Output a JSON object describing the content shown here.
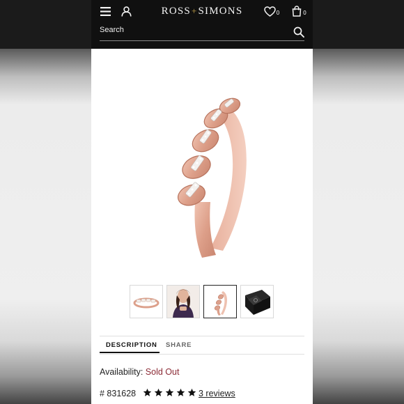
{
  "header": {
    "logo_left": "ROSS",
    "logo_sep": "+",
    "logo_right": "SIMONS",
    "wishlist_count": "0",
    "bag_count": "0",
    "search_label": "Search"
  },
  "gallery": {
    "main_image": "rose-gold-diamond-link-ring-icon",
    "thumbnails": [
      {
        "icon": "ring-side-thumbnail-icon",
        "active": false
      },
      {
        "icon": "model-wearing-ring-thumbnail-icon",
        "active": false
      },
      {
        "icon": "ring-angle-thumbnail-icon",
        "active": true
      },
      {
        "icon": "gift-box-thumbnail-icon",
        "active": false
      }
    ]
  },
  "tabs": {
    "description": "DESCRIPTION",
    "share": "SHARE"
  },
  "details": {
    "availability_label": "Availability:",
    "availability_value": "Sold Out",
    "sku": "# 831628",
    "rating": 5,
    "reviews": "3 reviews"
  },
  "colors": {
    "header_bg": "#101010",
    "brand_accent": "#c9a64a",
    "sold_out": "#8b2a35",
    "rose_gold": "#e3a994"
  }
}
